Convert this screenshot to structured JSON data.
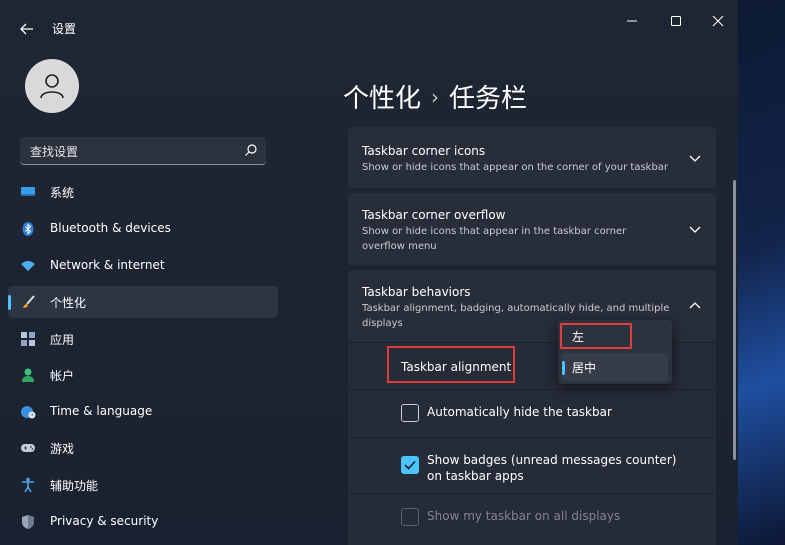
{
  "window": {
    "title": "设置",
    "controls": {
      "minimize": "—",
      "maximize": "☐",
      "close": "✕"
    }
  },
  "search": {
    "text": "查找设置"
  },
  "sidebar": {
    "items": [
      {
        "label": "系统",
        "icon": "monitor-icon"
      },
      {
        "label": "Bluetooth & devices",
        "icon": "bluetooth-icon"
      },
      {
        "label": "Network & internet",
        "icon": "wifi-icon"
      },
      {
        "label": "个性化",
        "icon": "brush-icon",
        "active": true
      },
      {
        "label": "应用",
        "icon": "apps-icon"
      },
      {
        "label": "帐户",
        "icon": "person-icon"
      },
      {
        "label": "Time & language",
        "icon": "globe-clock-icon"
      },
      {
        "label": "游戏",
        "icon": "gamepad-icon"
      },
      {
        "label": "辅助功能",
        "icon": "accessibility-icon"
      },
      {
        "label": "Privacy & security",
        "icon": "shield-icon"
      }
    ]
  },
  "breadcrumb": {
    "parent": "个性化",
    "separator": "›",
    "current": "任务栏"
  },
  "cards": {
    "corner_icons": {
      "title": "Taskbar corner icons",
      "desc": "Show or hide icons that appear on the corner of your taskbar"
    },
    "corner_overflow": {
      "title": "Taskbar corner overflow",
      "desc": "Show or hide icons that appear in the taskbar corner overflow menu"
    },
    "behaviors": {
      "title": "Taskbar behaviors",
      "desc": "Taskbar alignment, badging, automatically hide, and multiple displays"
    }
  },
  "behaviors": {
    "alignment_label": "Taskbar alignment",
    "alignment_options": [
      "左",
      "居中"
    ],
    "alignment_selected": "居中",
    "auto_hide": {
      "label": "Automatically hide the taskbar",
      "checked": false
    },
    "badges": {
      "label_line1": "Show badges (unread messages counter)",
      "label_line2": "on taskbar apps",
      "checked": true
    },
    "all_displays": {
      "label": "Show my taskbar on all displays",
      "checked": false,
      "disabled": true
    }
  },
  "colors": {
    "accent": "#4cc2ff",
    "highlight": "#e03c3c"
  }
}
